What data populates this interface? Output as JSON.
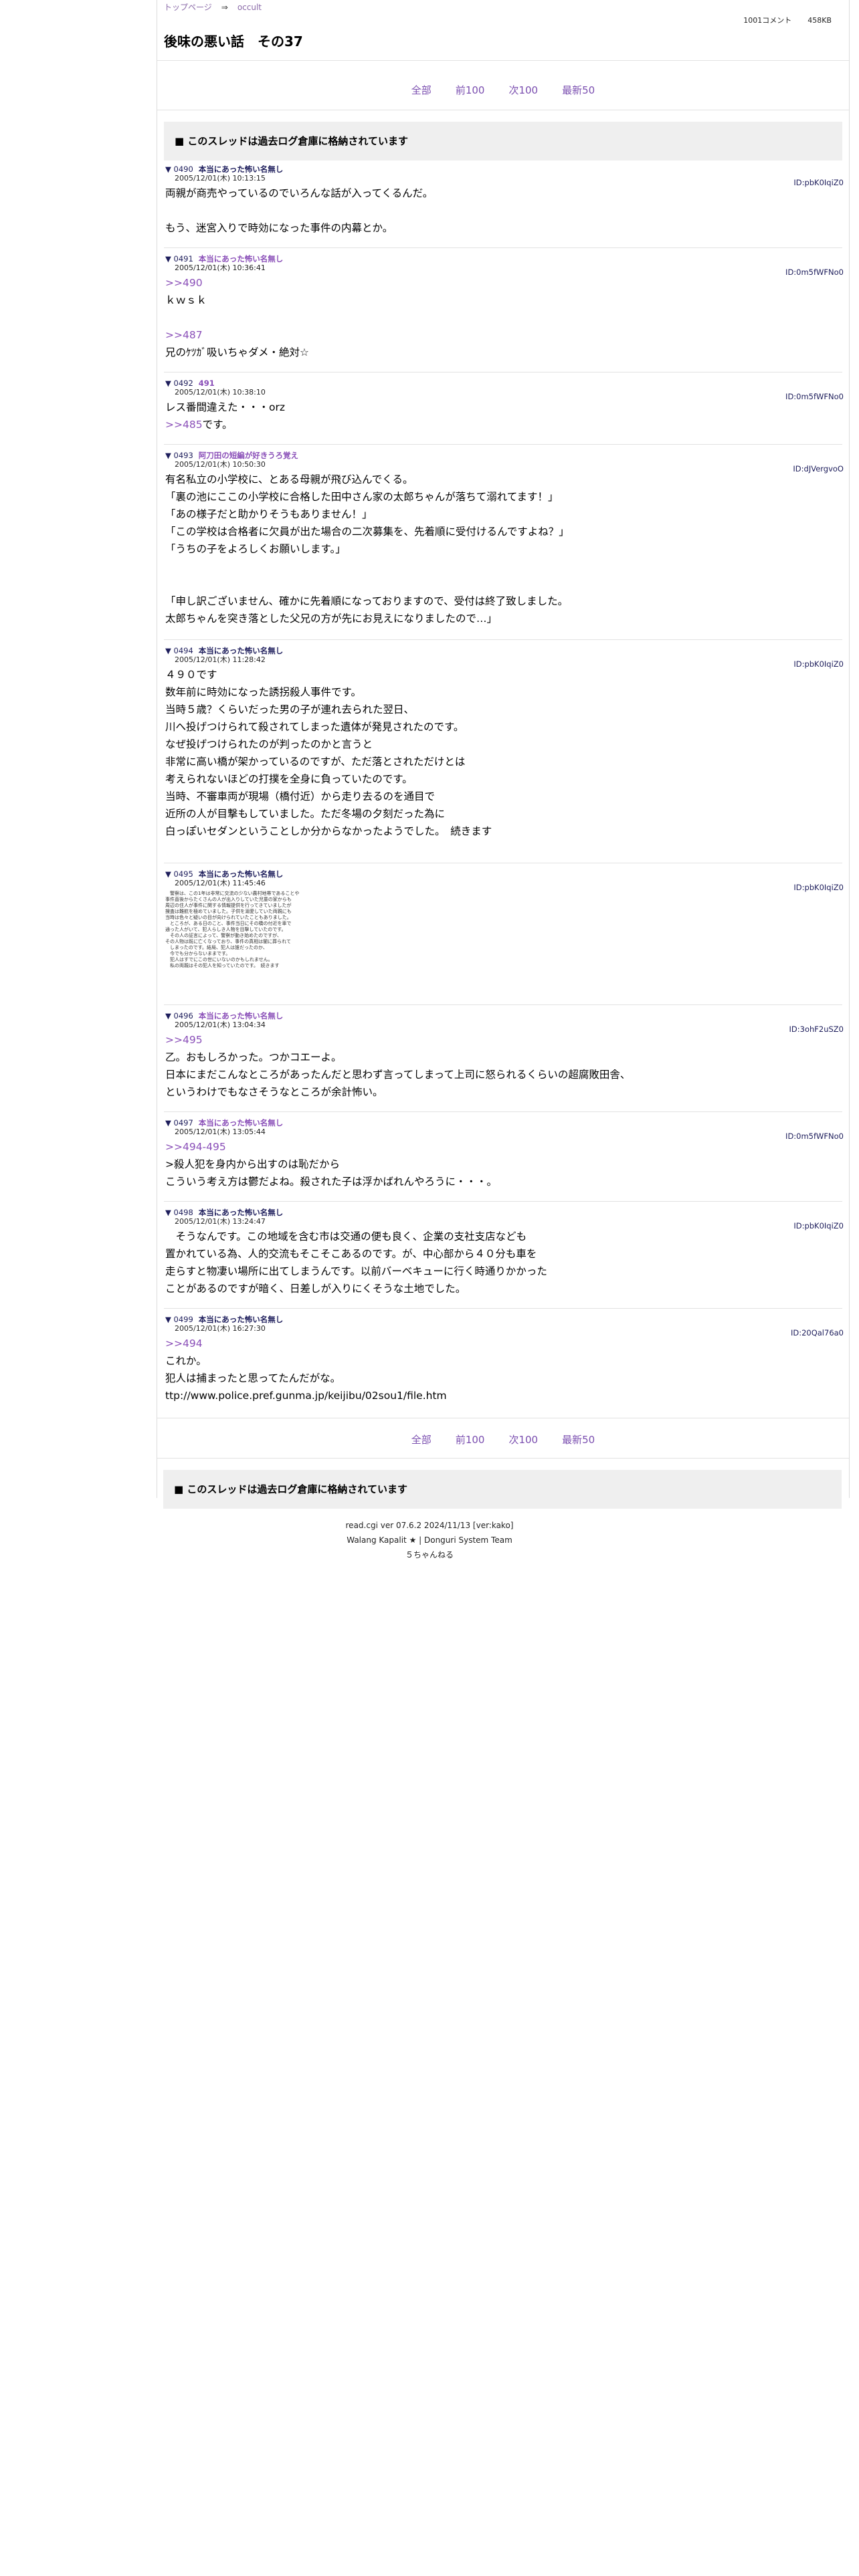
{
  "breadcrumb": {
    "home": "トップページ",
    "sep": "⇒",
    "board": "occult"
  },
  "thread_meta": {
    "comments": "1001コメント",
    "size": "458KB"
  },
  "title": "後味の悪い話　その37",
  "nav": {
    "all": "全部",
    "prev100": "前100",
    "next100": "次100",
    "latest50": "最新50"
  },
  "archived_notice": "■ このスレッドは過去ログ倉庫に格納されています",
  "posts": [
    {
      "no": "▼ 0490",
      "name": "本当にあった怖い名無し",
      "date": "2005/12/01(木) 10:13:15",
      "id": "ID:pbK0IqiZ0",
      "body": "両親が商売やっているのでいろんな話が入ってくるんだ。\n\nもう、迷宮入りで時効になった事件の内幕とか。"
    },
    {
      "no": "▼ 0491",
      "name": "本当にあった怖い名無し",
      "date": "2005/12/01(木) 10:36:41",
      "id": "ID:0m5fWFNo0",
      "anchor1": ">>490",
      "body1": "ｋｗｓｋ",
      "anchor2": ">>487",
      "body2": "兄のｹﾂｶﾞ吸いちゃダメ・絶対☆"
    },
    {
      "no": "▼ 0492",
      "name": "491",
      "date": "2005/12/01(木) 10:38:10",
      "id": "ID:0m5fWFNo0",
      "body1": "レス番間違えた・・・orz",
      "anchor": ">>485",
      "body2": "です。"
    },
    {
      "no": "▼ 0493",
      "name": "阿刀田の短編が好きうろ覚え",
      "date": "2005/12/01(木) 10:50:30",
      "id": "ID:dJVergvoO",
      "body": "有名私立の小学校に、とある母親が飛び込んでくる。\n「裏の池にここの小学校に合格した田中さん家の太郎ちゃんが落ちて溺れてます！」\n「あの様子だと助かりそうもありません！」\n「この学校は合格者に欠員が出た場合の二次募集を、先着順に受付けるんですよね？」\n「うちの子をよろしくお願いします。」\n\n\n「申し訳ございません、確かに先着順になっておりますので、受付は終了致しました。\n太郎ちゃんを突き落とした父兄の方が先にお見えになりましたので…」"
    },
    {
      "no": "▼ 0494",
      "name": "本当にあった怖い名無し",
      "date": "2005/12/01(木) 11:28:42",
      "id": "ID:pbK0IqiZ0",
      "body": "４９０です\n数年前に時効になった誘拐殺人事件です。\n当時５歳？くらいだった男の子が連れ去られた翌日、\n川へ投げつけられて殺されてしまった遺体が発見されたのです。\nなぜ投げつけられたのが判ったのかと言うと\n非常に高い橋が架かっているのですが、ただ落とされただけとは\n考えられないほどの打撲を全身に負っていたのです。\n当時、不審車両が現場（橋付近）から走り去るのを通目で\n近所の人が目撃もしていました。ただ冬場の夕刻だった為に\n白っぽいセダンということしか分からなかったようでした。　続きます"
    },
    {
      "no": "▼ 0495",
      "name": "本当にあった怖い名無し",
      "date": "2005/12/01(木) 11:45:46",
      "id": "ID:pbK0IqiZ0",
      "small_text": "　警察は、この1年は非常に交流の少ない農村地帯であることや\n事件直後からたくさんの人が出入りしていた児童の家からも\n周辺の住人が事件に関する情報提供を行ってきていましたが\n捜査は難航を極めていました。子供を溺愛していた両親にも\n当時は色々と疑いの目が向けられていたこともありました。\n　ところが、ある日のこと、事件当日にその橋の付近を車で\n通った人がいて、犯人らしき人物を目撃していたのです。\n　その人の証言によって、警察が動き始めたのですが、\nその人物は既に亡くなっており、事件の真相は闇に葬られて\n　しまったのです。結局、犯人は誰だったのか、\n　今でも分からないままです。\n　犯人はすでにこの世にいないのかもしれません。\n　私の両親はその犯人を知っていたのです。　続きます"
    },
    {
      "no": "▼ 0496",
      "name": "本当にあった怖い名無し",
      "date": "2005/12/01(木) 13:04:34",
      "id": "ID:3ohF2uSZ0",
      "anchor": ">>495",
      "body": "乙。おもしろかった。つかコエーよ。\n日本にまだこんなところがあったんだと思わず言ってしまって上司に怒られるくらいの超腐敗田舎、\nというわけでもなさそうなところが余計怖い。"
    },
    {
      "no": "▼ 0497",
      "name": "本当にあった怖い名無し",
      "date": "2005/12/01(木) 13:05:44",
      "id": "ID:0m5fWFNo0",
      "anchor": ">>494-495",
      "body": ">殺人犯を身内から出すのは恥だから\nこういう考え方は鬱だよね。殺された子は浮かばれんやろうに・・・。"
    },
    {
      "no": "▼ 0498",
      "name": "本当にあった怖い名無し",
      "date": "2005/12/01(木) 13:24:47",
      "id": "ID:pbK0IqiZ0",
      "body": "　そうなんです。この地域を含む市は交通の便も良く、企業の支社支店なども\n置かれている為、人的交流もそこそこあるのです。が、中心部から４０分も車を\n走らすと物凄い場所に出てしまうんです。以前バーベキューに行く時通りかかった\nことがあるのですが暗く、日差しが入りにくそうな土地でした。"
    },
    {
      "no": "▼ 0499",
      "name": "本当にあった怖い名無し",
      "date": "2005/12/01(木) 16:27:30",
      "id": "ID:20Qal76a0",
      "anchor": ">>494",
      "body": "これか。\n犯人は捕まったと思ってたんだがな。\nttp://www.police.pref.gunma.jp/keijibu/02sou1/file.htm"
    }
  ],
  "footer": {
    "line1": "read.cgi ver 07.6.2 2024/11/13 [ver:kako]",
    "line2": "Walang Kapalit ★ | Donguri System Team",
    "line3": "５ちゃんねる"
  }
}
